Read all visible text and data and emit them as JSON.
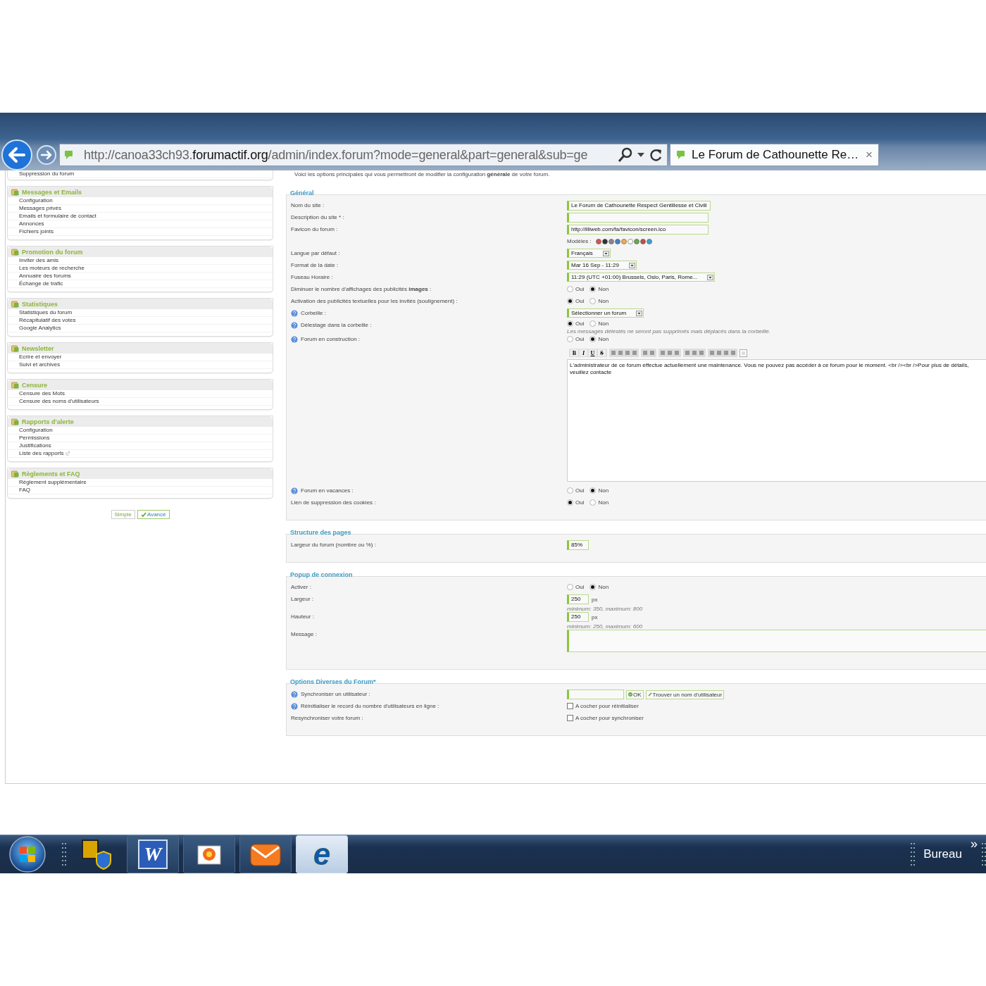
{
  "browser": {
    "url": {
      "prefix": "http://canoa33ch93.",
      "domain": "forumactif.org",
      "path": "/admin/index.forum?mode=general&part=general&sub=ge"
    },
    "tab": {
      "title": "Le Forum de Cathounette Re…",
      "close": "×",
      "selected": true
    }
  },
  "sidebar": {
    "groups": [
      {
        "items": [
          {
            "label": "Suppression du forum"
          }
        ]
      },
      {
        "title": "Messages et Emails",
        "items": [
          {
            "label": "Configuration"
          },
          {
            "label": "Messages privés"
          },
          {
            "label": "Emails et formulaire de contact"
          },
          {
            "label": "Annonces"
          },
          {
            "label": "Fichiers joints"
          }
        ]
      },
      {
        "title": "Promotion du forum",
        "items": [
          {
            "label": "Inviter des amis"
          },
          {
            "label": "Les moteurs de recherche"
          },
          {
            "label": "Annuaire des forums"
          },
          {
            "label": "Échange de trafic"
          }
        ]
      },
      {
        "title": "Statistiques",
        "items": [
          {
            "label": "Statistiques du forum"
          },
          {
            "label": "Récapitulatif des votes"
          },
          {
            "label": "Google Analytics"
          }
        ]
      },
      {
        "title": "Newsletter",
        "items": [
          {
            "label": "Ecrire et envoyer"
          },
          {
            "label": "Suivi et archives"
          }
        ]
      },
      {
        "title": "Censure",
        "items": [
          {
            "label": "Censure des Mots"
          },
          {
            "label": "Censure des noms d'utilisateurs"
          }
        ]
      },
      {
        "title": "Rapports d'alerte",
        "items": [
          {
            "label": "Configuration"
          },
          {
            "label": "Permissions"
          },
          {
            "label": "Justifications"
          },
          {
            "label": "Liste des rapports",
            "external": true
          }
        ]
      },
      {
        "title": "Règlements et FAQ",
        "items": [
          {
            "label": "Règlement supplémentaire"
          },
          {
            "label": "FAQ"
          }
        ]
      }
    ],
    "view_buttons": [
      {
        "label": "Simple",
        "selected": false
      },
      {
        "label": "Avancé",
        "selected": true
      }
    ]
  },
  "intro": "Voici les options principales qui vous permettront de modifier la configuration **générale** de votre forum.",
  "sections": [
    {
      "title": "Général",
      "rows": [
        {
          "label": "Nom du site :",
          "control": {
            "kind": "text",
            "value": "Le Forum de Cathounette Respect Gentillesse et Civili"
          }
        },
        {
          "label": "Description du site * :",
          "control": {
            "kind": "text"
          }
        },
        {
          "label": "Favicon du forum :",
          "control": {
            "kind": "text",
            "value": "http://illiweb.com/fa/favicon/screen.ico"
          }
        },
        {
          "control": {
            "kind": "icons",
            "label": "Modèles :"
          }
        },
        {
          "label": "Langue par défaut :",
          "control": {
            "kind": "select",
            "value": "Français"
          }
        },
        {
          "label": "Format de la date :",
          "control": {
            "kind": "select",
            "value": "Mar 16 Sep - 11:29"
          }
        },
        {
          "label": "Fuseau Horaire :",
          "control": {
            "kind": "select",
            "value": "11:29 (UTC +01:00) Brussels, Oslo, Paris, Rome..."
          }
        },
        {
          "label": "Diminuer le nombre d'affichages des publicités **images** :",
          "control": {
            "kind": "radio",
            "options": [
              {
                "label": "Oui",
                "selected": false
              },
              {
                "label": "Non",
                "selected": true
              }
            ]
          }
        },
        {
          "label": "Activation des publicités textuelles pour les invités (soulignement) :",
          "control": {
            "kind": "radio",
            "options": [
              {
                "label": "Oui",
                "selected": true
              },
              {
                "label": "Non",
                "selected": false
              }
            ]
          }
        },
        {
          "label": "Corbeille :",
          "help": true,
          "control": {
            "kind": "select",
            "value": "Sélectionner un forum"
          }
        },
        {
          "label": "Délestage dans la corbeille :",
          "help": true,
          "control": {
            "kind": "radio",
            "options": [
              {
                "label": "Oui",
                "selected": true
              },
              {
                "label": "Non",
                "selected": false
              }
            ],
            "note": "Les messages délestés ne seront pas supprimés mais déplacés dans la corbeille."
          }
        },
        {
          "label": "Forum en construction :",
          "help": true,
          "control": {
            "kind": "radio",
            "options": [
              {
                "label": "Oui",
                "selected": false
              },
              {
                "label": "Non",
                "selected": true
              }
            ]
          }
        },
        {
          "control": {
            "kind": "editor",
            "buttons": [
              "B",
              "I",
              "U",
              "S"
            ],
            "value": "L'administrateur de ce forum effectue actuellement une maintenance. Vous ne pouvez pas accéder à ce forum pour le moment. <br /><br />Pour plus de détails, veuillez contacte"
          }
        },
        {
          "label": "Forum en vacances :",
          "help": true,
          "control": {
            "kind": "radio",
            "options": [
              {
                "label": "Oui",
                "selected": false
              },
              {
                "label": "Non",
                "selected": true
              }
            ]
          }
        },
        {
          "label": "Lien de suppression des cookies :",
          "control": {
            "kind": "radio",
            "options": [
              {
                "label": "Oui",
                "selected": true
              },
              {
                "label": "Non",
                "selected": false
              }
            ]
          }
        }
      ]
    },
    {
      "title": "Structure des pages",
      "rows": [
        {
          "label": "Largeur du forum (nombre ou %) :",
          "control": {
            "kind": "size",
            "value": "85%"
          }
        }
      ]
    },
    {
      "title": "Popup de connexion",
      "rows": [
        {
          "label": "Activer :",
          "control": {
            "kind": "radio",
            "options": [
              {
                "label": "Oui",
                "selected": false
              },
              {
                "label": "Non",
                "selected": true
              }
            ]
          }
        },
        {
          "label": "Largeur :",
          "control": {
            "kind": "size",
            "value": "250",
            "unit": "px",
            "hint": "minimum: 350, maximum: 800"
          }
        },
        {
          "label": "Hauteur :",
          "control": {
            "kind": "size",
            "value": "250",
            "unit": "px",
            "hint": "minimum: 250, maximum: 600"
          }
        },
        {
          "label": "Message :",
          "control": {
            "kind": "textarea"
          }
        }
      ]
    },
    {
      "title": "Options Diverses du Forum*",
      "rows": [
        {
          "label": "Synchroniser un utilisateur :",
          "help": true,
          "control": {
            "kind": "sync",
            "ok": "OK",
            "find": "Trouver un nom d'utilisateur"
          }
        },
        {
          "label": "Réinitialiser le record du nombre d'utilisateurs en ligne :",
          "help": true,
          "control": {
            "kind": "checkbox",
            "label": "A cocher pour réinitialiser",
            "checked": false
          }
        },
        {
          "label": "Resynchroniser votre forum :",
          "control": {
            "kind": "checkbox",
            "label": "A cocher pour synchroniser",
            "checked": false
          }
        }
      ]
    }
  ],
  "taskbar": {
    "apps": [
      {
        "kind": "security"
      },
      {
        "kind": "word",
        "glyph": "W",
        "selected": false
      },
      {
        "kind": "photo",
        "selected": false
      },
      {
        "kind": "mail",
        "selected": false
      },
      {
        "kind": "ie",
        "glyph": "e",
        "selected": true
      }
    ],
    "desktop": "Bureau",
    "chevron": "»"
  }
}
